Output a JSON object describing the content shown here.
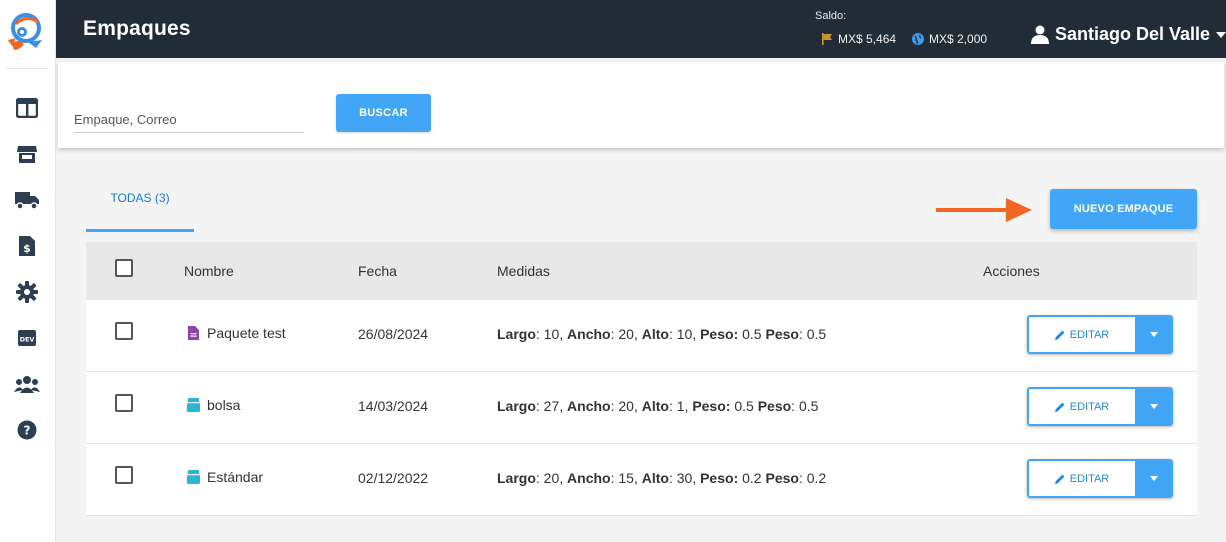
{
  "header": {
    "title": "Empaques",
    "saldo_label": "Saldo:",
    "balances": [
      {
        "icon": "flag-icon",
        "amount": "MX$ 5,464",
        "color": "#c8962a"
      },
      {
        "icon": "globe-icon",
        "amount": "MX$ 2,000",
        "color": "#3d9be9"
      }
    ],
    "user_name": "Santiago Del Valle"
  },
  "sidebar": {
    "items": [
      {
        "icon": "dashboard-icon"
      },
      {
        "icon": "store-icon"
      },
      {
        "icon": "truck-icon"
      },
      {
        "icon": "invoice-icon"
      },
      {
        "icon": "gear-icon"
      },
      {
        "icon": "dev-icon",
        "label": "DEV"
      },
      {
        "icon": "users-icon"
      },
      {
        "icon": "help-icon"
      }
    ]
  },
  "search": {
    "placeholder": "Empaque, Correo",
    "button_label": "BUSCAR"
  },
  "tabs": [
    {
      "label": "TODAS (3)",
      "active": true
    }
  ],
  "new_button_label": "NUEVO EMPAQUE",
  "table": {
    "headers": {
      "nombre": "Nombre",
      "fecha": "Fecha",
      "medidas": "Medidas",
      "acciones": "Acciones"
    },
    "rows": [
      {
        "icon": "file-icon",
        "icon_color": "#8e44ad",
        "nombre": "Paquete test",
        "fecha": "26/08/2024",
        "largo": "10",
        "ancho": "20",
        "alto": "10",
        "peso": "0.5",
        "peso2": "0.5",
        "edit_label": "EDITAR"
      },
      {
        "icon": "box-icon",
        "icon_color": "#29b6d6",
        "nombre": "bolsa",
        "fecha": "14/03/2024",
        "largo": "27",
        "ancho": "20",
        "alto": "1",
        "peso": "0.5",
        "peso2": "0.5",
        "edit_label": "EDITAR"
      },
      {
        "icon": "box-icon",
        "icon_color": "#29b6d6",
        "nombre": "Estándar",
        "fecha": "02/12/2022",
        "largo": "20",
        "ancho": "15",
        "alto": "30",
        "peso": "0.2",
        "peso2": "0.2",
        "edit_label": "EDITAR"
      }
    ],
    "measure_labels": {
      "largo": "Largo",
      "ancho": "Ancho",
      "alto": "Alto",
      "peso": "Peso"
    }
  },
  "colors": {
    "accent": "#42a5f5",
    "header_bg": "#222c37",
    "arrow": "#f26522"
  }
}
